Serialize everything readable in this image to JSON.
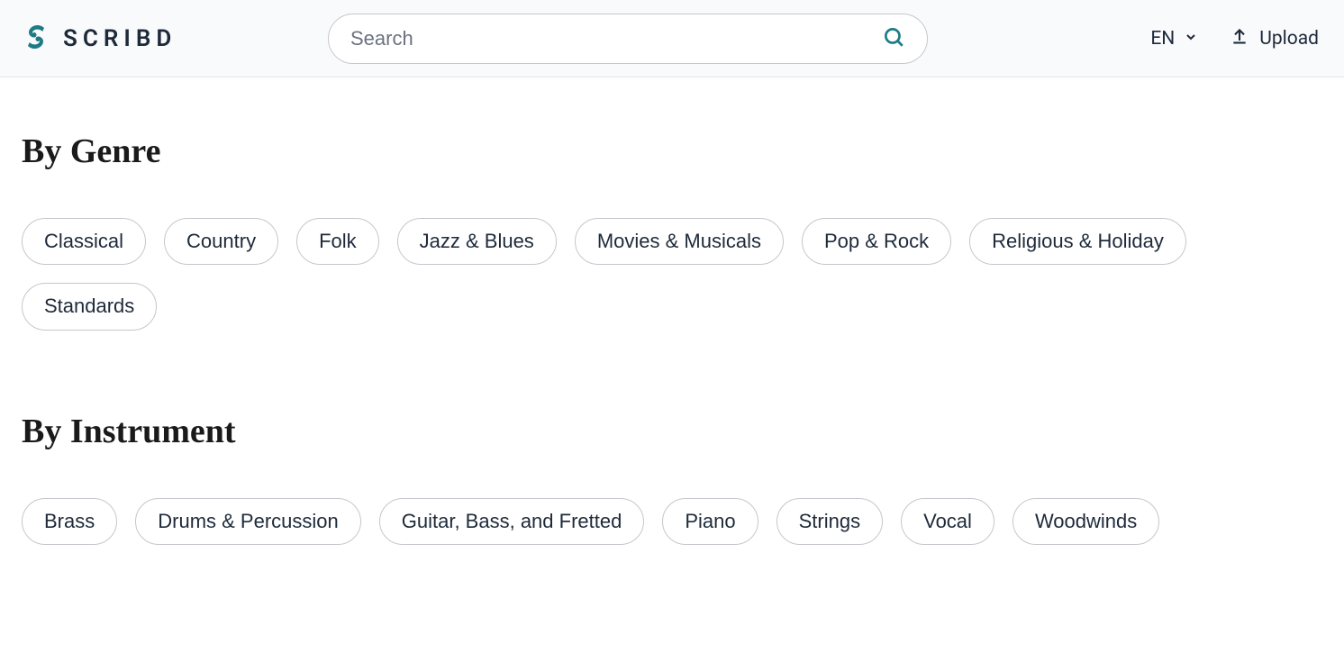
{
  "header": {
    "brand": "SCRIBD",
    "search_placeholder": "Search",
    "language": "EN",
    "upload_label": "Upload"
  },
  "sections": {
    "genre": {
      "title": "By Genre",
      "items": [
        "Classical",
        "Country",
        "Folk",
        "Jazz & Blues",
        "Movies & Musicals",
        "Pop & Rock",
        "Religious & Holiday",
        "Standards"
      ]
    },
    "instrument": {
      "title": "By Instrument",
      "items": [
        "Brass",
        "Drums & Percussion",
        "Guitar, Bass, and Fretted",
        "Piano",
        "Strings",
        "Vocal",
        "Woodwinds"
      ]
    }
  }
}
